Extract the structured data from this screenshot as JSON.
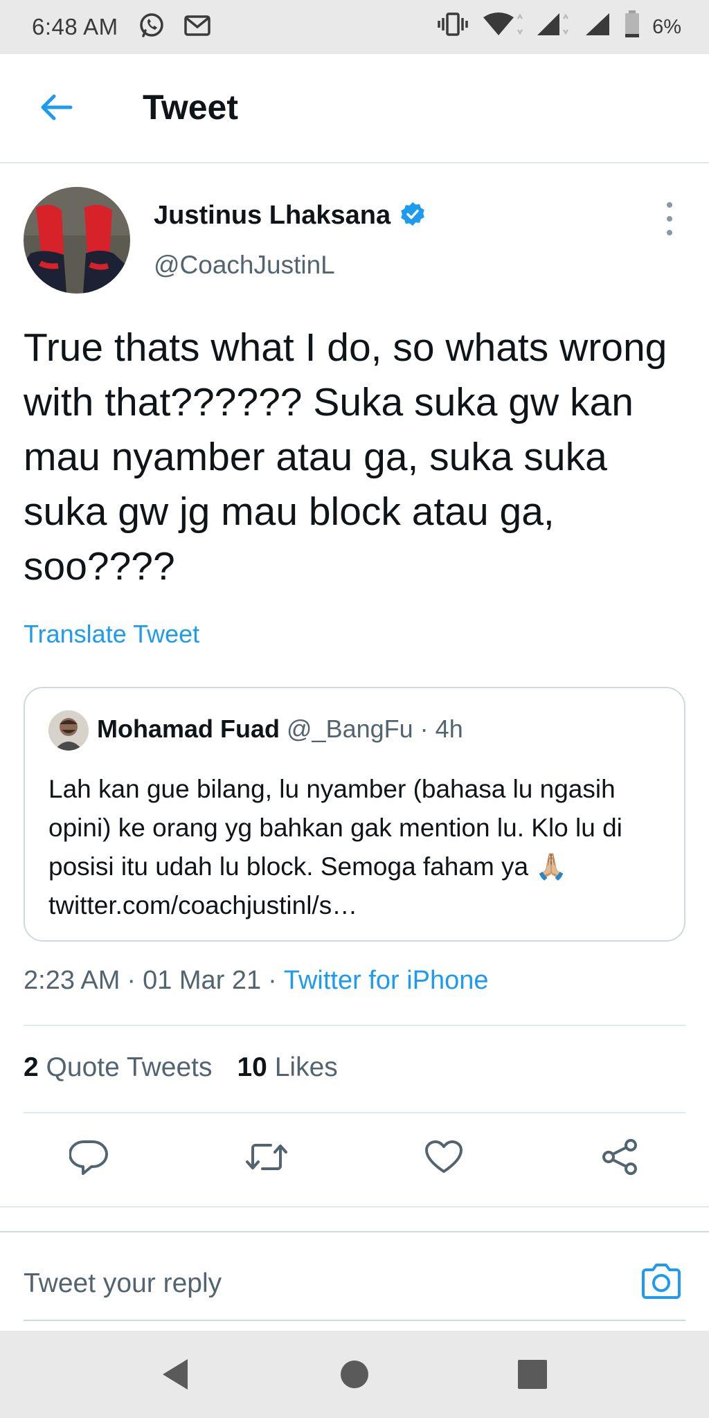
{
  "status_bar": {
    "time": "6:48 AM",
    "battery": "6%",
    "icons": [
      "whatsapp-icon",
      "gmail-icon",
      "vibrate-icon",
      "wifi-icon",
      "signal-icon",
      "signal-icon",
      "battery-icon"
    ]
  },
  "header": {
    "title": "Tweet",
    "back_icon": "back-arrow-icon"
  },
  "tweet": {
    "author_name": "Justinus Lhaksana",
    "author_handle": "@CoachJustinL",
    "verified": true,
    "text": "True thats what I do, so whats wrong with that?????? Suka suka gw kan mau nyamber atau ga, suka suka suka gw jg mau block atau ga, soo????",
    "translate_label": "Translate Tweet",
    "time": "2:23 AM",
    "date": "01 Mar 21",
    "separator": "·",
    "source": "Twitter for iPhone"
  },
  "quoted_tweet": {
    "author_name": "Mohamad Fuad",
    "author_handle": "@_BangFu",
    "separator": "·",
    "time": "4h",
    "text": "Lah kan gue bilang, lu nyamber (bahasa lu ngasih opini) ke orang yg bahkan gak mention lu. Klo lu di posisi itu udah lu block. Semoga faham ya 🙏🏼 twitter.com/coachjustinl/s…"
  },
  "stats": {
    "quote_count": "2",
    "quote_label": "Quote Tweets",
    "like_count": "10",
    "like_label": "Likes"
  },
  "actions": [
    "reply-icon",
    "retweet-icon",
    "like-icon",
    "share-icon"
  ],
  "reply": {
    "placeholder": "Tweet your reply",
    "camera_icon": "camera-icon"
  },
  "colors": {
    "accent": "#1d9bf0",
    "text": "#0f1419",
    "secondary": "#536471",
    "border": "#cfd9de"
  }
}
